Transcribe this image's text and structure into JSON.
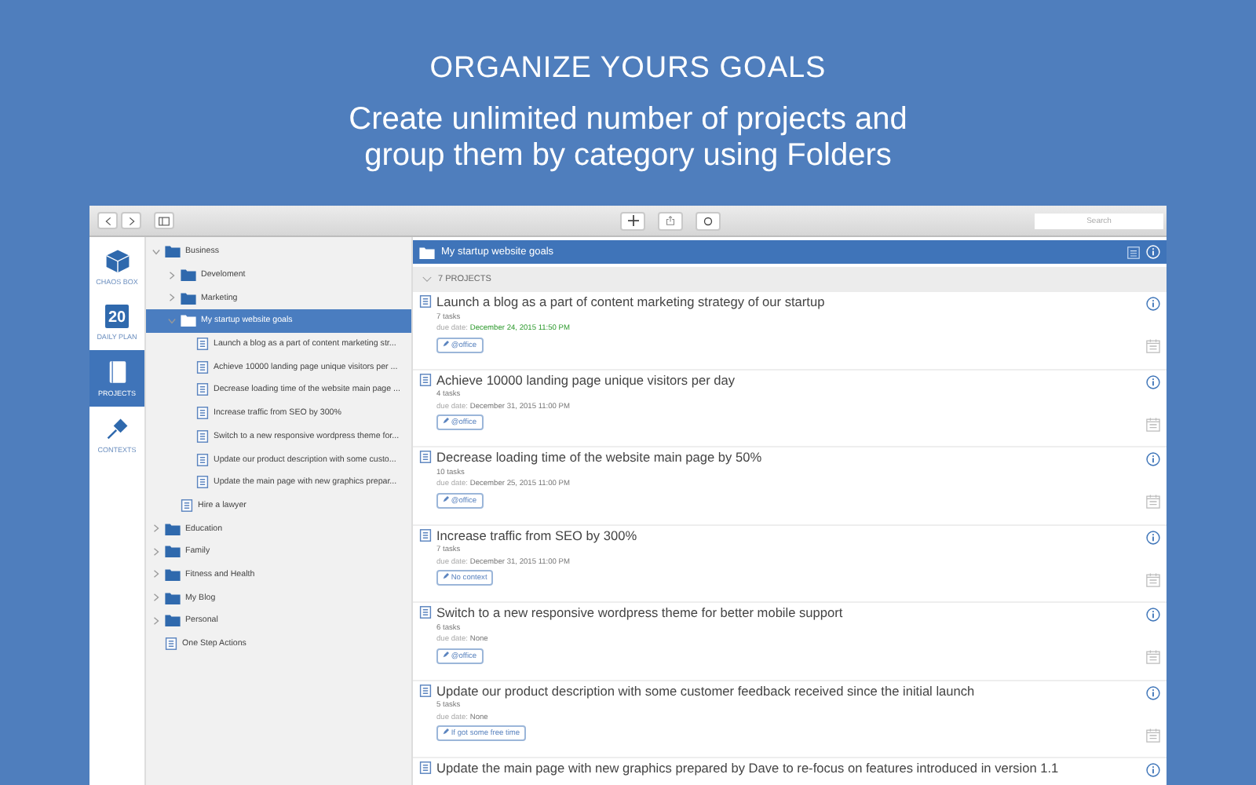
{
  "headline": "ORGANIZE YOURS GOALS",
  "subline": "Create unlimited number of projects and group them by category using Folders",
  "search": {
    "placeholder": "Search"
  },
  "nav": [
    {
      "label": "CHAOS BOX",
      "kind": "box",
      "selected": false
    },
    {
      "label": "DAILY PLAN",
      "kind": "calendar",
      "day": "20",
      "selected": false
    },
    {
      "label": "PROJECTS",
      "kind": "notebook",
      "selected": true
    },
    {
      "label": "CONTEXTS",
      "kind": "pin",
      "selected": false
    }
  ],
  "tree": [
    {
      "label": "Business",
      "kind": "folder",
      "expanded": true,
      "selected": false,
      "children": [
        {
          "label": "Develoment",
          "kind": "folder",
          "expanded": false,
          "selected": false
        },
        {
          "label": "Marketing",
          "kind": "folder",
          "expanded": false,
          "selected": false
        },
        {
          "label": "My startup website goals",
          "kind": "folder",
          "expanded": true,
          "selected": true,
          "children": [
            {
              "label": "Launch a blog as a part of content marketing str...",
              "kind": "doc",
              "selected": false
            },
            {
              "label": "Achieve 10000 landing page unique visitors per ...",
              "kind": "doc",
              "selected": false
            },
            {
              "label": "Decrease loading time of the website main page ...",
              "kind": "doc",
              "selected": false
            },
            {
              "label": "Increase traffic from SEO by 300%",
              "kind": "doc",
              "selected": false
            },
            {
              "label": "Switch to a new responsive wordpress theme for...",
              "kind": "doc",
              "selected": false
            },
            {
              "label": "Update our product description with some custo...",
              "kind": "doc",
              "selected": false
            },
            {
              "label": "Update the main page with new graphics prepar...",
              "kind": "doc",
              "selected": false
            }
          ]
        },
        {
          "label": "Hire a lawyer",
          "kind": "doc",
          "selected": false
        }
      ]
    },
    {
      "label": "Education",
      "kind": "folder",
      "expanded": false,
      "selected": false
    },
    {
      "label": "Family",
      "kind": "folder",
      "expanded": false,
      "selected": false
    },
    {
      "label": "Fitness and Health",
      "kind": "folder",
      "expanded": false,
      "selected": false
    },
    {
      "label": "My Blog",
      "kind": "folder",
      "expanded": false,
      "selected": false
    },
    {
      "label": "Personal",
      "kind": "folder",
      "expanded": false,
      "selected": false
    },
    {
      "label": "One Step Actions",
      "kind": "doc",
      "selected": false
    }
  ],
  "detail": {
    "title": "My startup website goals",
    "count": "7 PROJECTS",
    "projects": [
      {
        "title": "Launch a blog as a part of content marketing strategy of our startup",
        "tasks": "7 tasks",
        "due_label": "due date:",
        "due": "December 24, 2015 11:50 PM",
        "due_highlight": true,
        "tag": "@office"
      },
      {
        "title": "Achieve 10000 landing page unique visitors per day",
        "tasks": "4 tasks",
        "due_label": "due date:",
        "due": "December 31, 2015 11:00 PM",
        "due_highlight": false,
        "tag": "@office"
      },
      {
        "title": "Decrease loading time of the website main page by 50%",
        "tasks": "10 tasks",
        "due_label": "due date:",
        "due": "December 25, 2015 11:00 PM",
        "due_highlight": false,
        "tag": "@office"
      },
      {
        "title": "Increase traffic from SEO by 300%",
        "tasks": "7 tasks",
        "due_label": "due date:",
        "due": "December 31, 2015 11:00 PM",
        "due_highlight": false,
        "tag": "No context"
      },
      {
        "title": "Switch to a new responsive wordpress theme for better mobile support",
        "tasks": "6 tasks",
        "due_label": "due date:",
        "due": "None",
        "due_highlight": false,
        "tag": "@office"
      },
      {
        "title": "Update our product description with some customer feedback received since the initial launch",
        "tasks": "5 tasks",
        "due_label": "due date:",
        "due": "None",
        "due_highlight": false,
        "tag": "If got some free time"
      },
      {
        "title": "Update the main page with new graphics prepared by Dave to re-focus on features introduced in version 1.1"
      }
    ]
  }
}
